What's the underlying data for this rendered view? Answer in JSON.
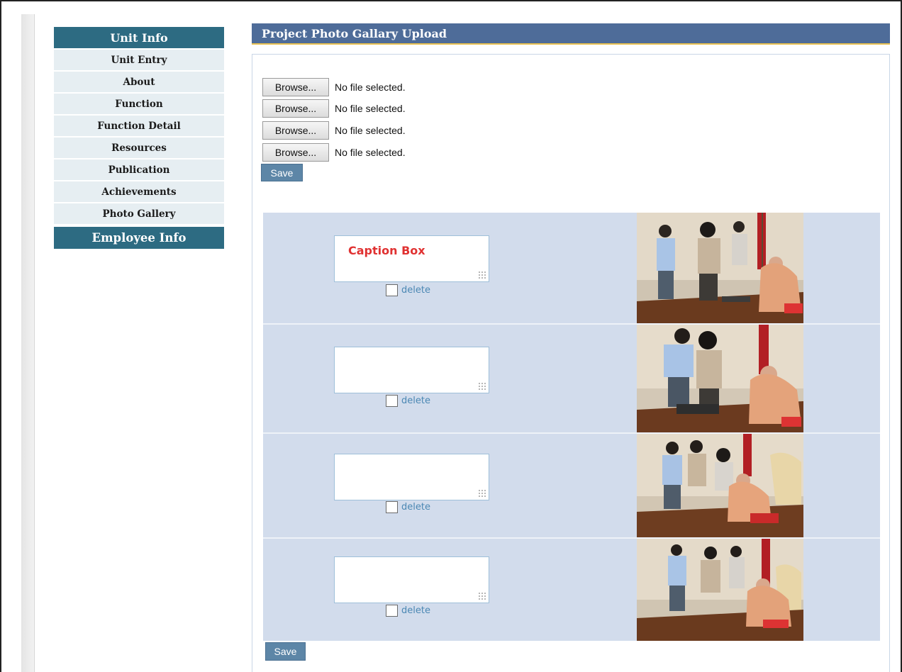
{
  "sidebar": {
    "unit_header": "Unit Info",
    "items": [
      {
        "label": "Unit Entry"
      },
      {
        "label": "About"
      },
      {
        "label": "Function"
      },
      {
        "label": "Function Detail"
      },
      {
        "label": "Resources"
      },
      {
        "label": "Publication"
      },
      {
        "label": "Achievements"
      },
      {
        "label": "Photo Gallery"
      }
    ],
    "employee_header": "Employee Info"
  },
  "main": {
    "title": "Project Photo Gallary Upload",
    "uploads": [
      {
        "button": "Browse...",
        "status": "No file selected."
      },
      {
        "button": "Browse...",
        "status": "No file selected."
      },
      {
        "button": "Browse...",
        "status": "No file selected."
      },
      {
        "button": "Browse...",
        "status": "No file selected."
      }
    ],
    "save_label": "Save",
    "gallery": [
      {
        "caption": "Caption Box",
        "delete_label": "delete",
        "photo_icon": "photo-icon"
      },
      {
        "caption": "",
        "delete_label": "delete",
        "photo_icon": "photo-icon"
      },
      {
        "caption": "",
        "delete_label": "delete",
        "photo_icon": "photo-icon"
      },
      {
        "caption": "",
        "delete_label": "delete",
        "photo_icon": "photo-icon"
      }
    ],
    "bottom_save_label": "Save"
  },
  "colors": {
    "sidebar_header": "#2d6b82",
    "title_bar": "#4e6c99",
    "title_underline": "#e8c050",
    "gallery_bg": "#d2dcec",
    "save_button": "#5d86a7",
    "caption_text": "#e03131",
    "delete_link": "#4a87b3"
  }
}
